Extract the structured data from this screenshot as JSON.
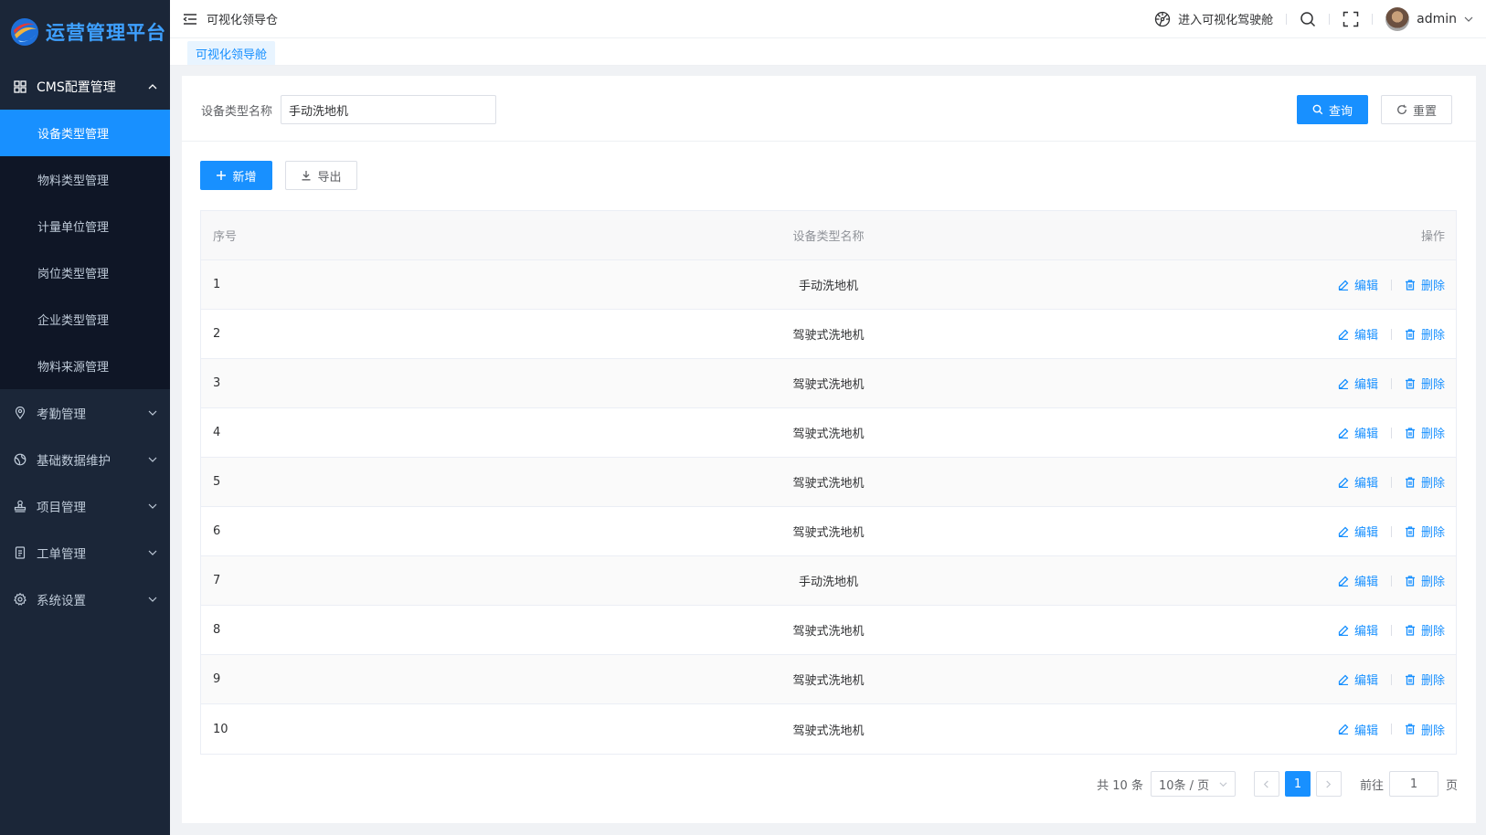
{
  "brand": {
    "title": "运营管理平台"
  },
  "sidebar": {
    "open_group": {
      "label": "CMS配置管理",
      "items": [
        {
          "label": "设备类型管理",
          "active": true
        },
        {
          "label": "物料类型管理"
        },
        {
          "label": "计量单位管理"
        },
        {
          "label": "岗位类型管理"
        },
        {
          "label": "企业类型管理"
        },
        {
          "label": "物料来源管理"
        }
      ]
    },
    "groups": [
      {
        "label": "考勤管理",
        "icon": "location-icon"
      },
      {
        "label": "基础数据维护",
        "icon": "globe-icon"
      },
      {
        "label": "项目管理",
        "icon": "stamp-icon"
      },
      {
        "label": "工单管理",
        "icon": "document-icon"
      },
      {
        "label": "系统设置",
        "icon": "gear-icon"
      }
    ]
  },
  "header": {
    "breadcrumb": "可视化领导仓",
    "enter_link": "进入可视化驾驶舱",
    "user": "admin"
  },
  "tags": {
    "active": "可视化领导舱"
  },
  "search": {
    "label": "设备类型名称",
    "value": "手动洗地机",
    "query_btn": "查询",
    "reset_btn": "重置"
  },
  "toolbar": {
    "add": "新增",
    "export": "导出"
  },
  "table": {
    "headers": {
      "index": "序号",
      "name": "设备类型名称",
      "ops": "操作"
    },
    "edit": "编辑",
    "delete": "删除",
    "rows": [
      {
        "index": "1",
        "name": "手动洗地机"
      },
      {
        "index": "2",
        "name": "驾驶式洗地机"
      },
      {
        "index": "3",
        "name": "驾驶式洗地机"
      },
      {
        "index": "4",
        "name": "驾驶式洗地机"
      },
      {
        "index": "5",
        "name": "驾驶式洗地机"
      },
      {
        "index": "6",
        "name": "驾驶式洗地机"
      },
      {
        "index": "7",
        "name": "手动洗地机"
      },
      {
        "index": "8",
        "name": "驾驶式洗地机"
      },
      {
        "index": "9",
        "name": "驾驶式洗地机"
      },
      {
        "index": "10",
        "name": "驾驶式洗地机"
      }
    ]
  },
  "pagination": {
    "total": "共 10 条",
    "page_size": "10条 / 页",
    "current": "1",
    "goto_label": "前往",
    "goto_value": "1",
    "page_unit": "页"
  },
  "colors": {
    "primary": "#1890ff",
    "sidebar": "#1b2638",
    "submenu": "#0f1626"
  }
}
